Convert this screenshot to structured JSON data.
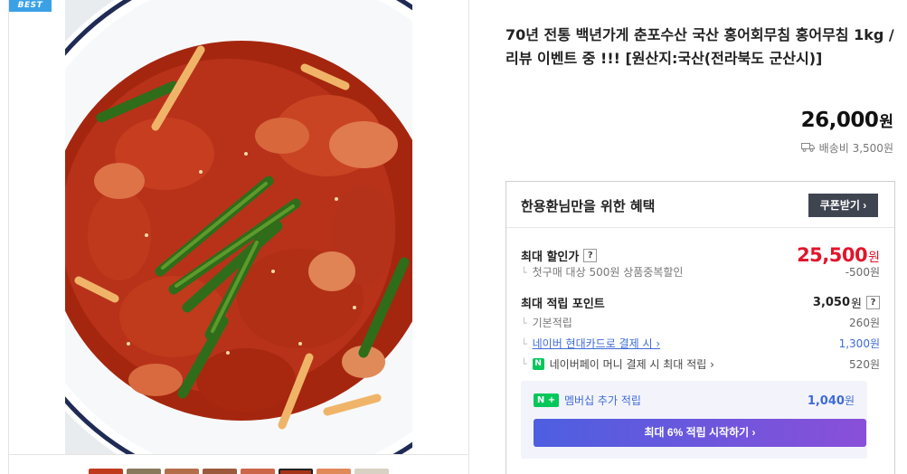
{
  "gallery": {
    "badge": "BEST",
    "thumb_count": 8,
    "active_thumb": 6
  },
  "product": {
    "title": "70년 전통 백년가게 춘포수산 국산 홍어회무침 홍어무침 1kg / 리뷰 이벤트 중 !!! [원산지:국산(전라북도 군산시)]",
    "price": "26,000",
    "price_unit": "원",
    "shipping": "배송비 3,500원"
  },
  "benefits": {
    "title": "한용환님만을 위한 혜택",
    "coupon_button": "쿠폰받기 ›",
    "max_discount": {
      "label": "최대 할인가",
      "help": "?",
      "price": "25,500",
      "unit": "원",
      "sub_label": "첫구매 대상 500원 상품중복할인",
      "sub_value": "-500원"
    },
    "points": {
      "label": "최대 적립 포인트",
      "help": "?",
      "value": "3,050",
      "unit": "원",
      "items": [
        {
          "label": "기본적립",
          "value": "260원"
        },
        {
          "label": "네이버 현대카드로 결제 시 ›",
          "value": "1,300원"
        },
        {
          "label": "네이버페이 머니 결제 시 최대 적립 ›",
          "value": "520원"
        }
      ]
    },
    "membership": {
      "badge": "N +",
      "label": "멤버십 추가 적립",
      "value": "1,040",
      "unit": "원",
      "button": "최대 6% 적립 시작하기 ›"
    }
  },
  "colors": {
    "accent_red": "#e0162b",
    "link_blue": "#3f6bd8",
    "naver_green": "#03c75a",
    "dark_button": "#3f4451"
  }
}
